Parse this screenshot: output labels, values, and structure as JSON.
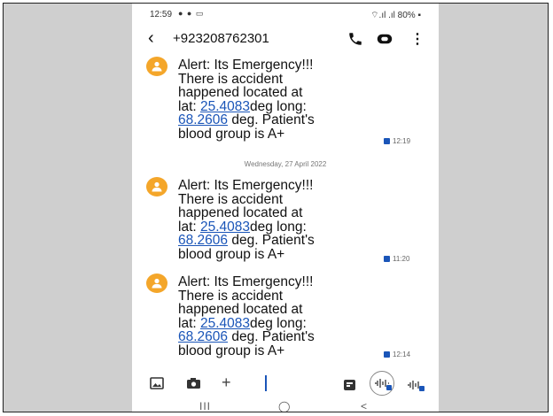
{
  "status_bar": {
    "time": "12:59",
    "left_icons": "● ● ▭",
    "right_text": "⌔.ıl .ıl 80% ▪"
  },
  "header": {
    "back_icon": "back-arrow-icon",
    "contact": "+923208762301",
    "call_icon": "phone-icon",
    "video_icon": "video-icon",
    "more_icon": "more-vertical-icon"
  },
  "messages": [
    {
      "line1": "Alert: Its Emergency!!!",
      "line2": "There is accident",
      "line3": "happened located at",
      "lat_prefix": "lat: ",
      "lat": "25.4083",
      "lat_suffix": "deg long:",
      "long": "68.2606",
      "long_suffix": " deg. Patient's",
      "line6": "blood group is A+",
      "time": "12:19"
    },
    {
      "line1": "Alert: Its Emergency!!!",
      "line2": "There is accident",
      "line3": "happened located at",
      "lat_prefix": "lat: ",
      "lat": "25.4083",
      "lat_suffix": "deg long:",
      "long": "68.2606",
      "long_suffix": " deg. Patient's",
      "line6": "blood group is A+",
      "time": "11:20"
    },
    {
      "line1": "Alert: Its Emergency!!!",
      "line2": "There is accident",
      "line3": "happened located at",
      "lat_prefix": "lat: ",
      "lat": "25.4083",
      "lat_suffix": "deg long:",
      "long": "68.2606",
      "long_suffix": " deg. Patient's",
      "line6": "blood group is A+",
      "time": "12:14"
    }
  ],
  "date_divider": "Wednesday, 27 April 2022",
  "composer": {
    "gallery_icon": "gallery-icon",
    "camera_icon": "camera-icon",
    "plus_label": "+",
    "sticker_icon": "sticker-icon",
    "voice_icon": "voice-icon",
    "voice2_icon": "voice-record-icon"
  },
  "navbar": {
    "recents": "III",
    "home": "◯",
    "back": "<"
  },
  "colors": {
    "avatar": "#f4a62a",
    "link": "#1a55b8",
    "background": "#cfcfcf"
  }
}
